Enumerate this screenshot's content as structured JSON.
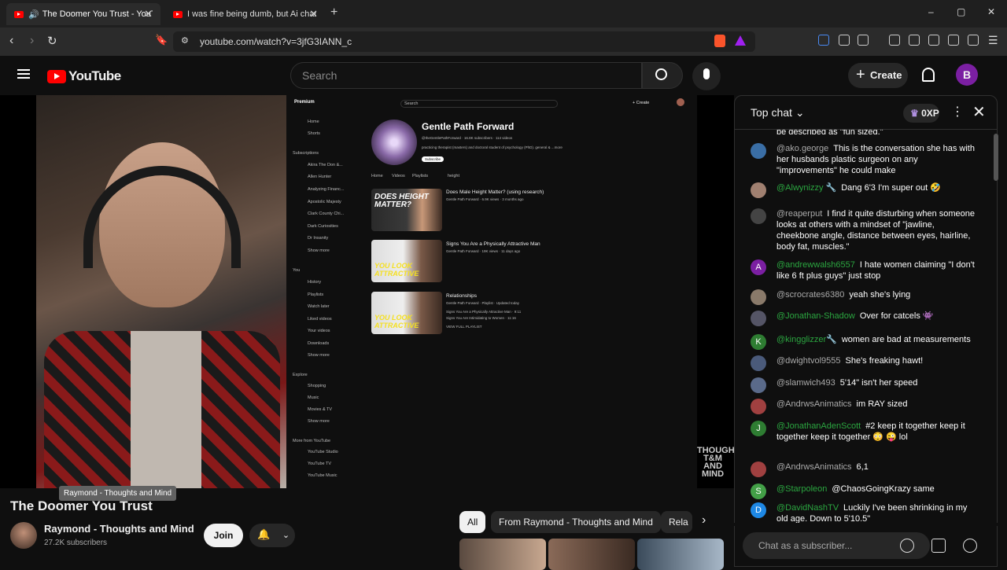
{
  "browser": {
    "tabs": [
      {
        "title": "The Doomer You Trust - YouTube",
        "active": true
      },
      {
        "title": "I was fine being dumb, but Ai change",
        "active": false
      }
    ],
    "url": "youtube.com/watch?v=3jfG3IANN_c",
    "new_tab": "+",
    "window_controls": [
      "–",
      "▢",
      "✕"
    ]
  },
  "youtube": {
    "logo": "YouTube",
    "search_placeholder": "Search",
    "create_label": "Create",
    "avatar_letter": "B"
  },
  "embedded": {
    "premium": "Premium",
    "search": "Search",
    "create": "+ Create",
    "sidebar": [
      "Home",
      "Shorts",
      "Subscriptions",
      "Akira The Don &...",
      "Allen Hunter",
      "Analyzing Financ...",
      "Apostolic Majesty",
      "Clark County Chi...",
      "Dark Curiosities",
      "Dr Insanity",
      "Show more",
      "You",
      "History",
      "Playlists",
      "Watch later",
      "Liked videos",
      "Your videos",
      "Downloads",
      "Show more",
      "Explore",
      "Shopping",
      "Music",
      "Movies & TV",
      "Show more",
      "More from YouTube",
      "YouTube Studio",
      "YouTube TV",
      "YouTube Music"
    ],
    "channel_name": "Gentle Path Forward",
    "channel_handle": "@theGentlePathForward · 16.8K subscribers · 114 videos",
    "channel_desc": "practicing therapist (masters) and doctoral student of psychology (PhD). general & ...more",
    "subscribe": "Subscribe",
    "tabs": [
      "Home",
      "Videos",
      "Playlists",
      "height"
    ],
    "videos": [
      {
        "title": "Does Male Height Matter? (using research)",
        "meta": "Gentle Path Forward · 6.9K views · 3 months ago",
        "thumb_text": "DOES HEIGHT MATTER?"
      },
      {
        "title": "Signs You Are a Physically Attractive Man",
        "meta": "Gentle Path Forward · 19K views · 11 days ago",
        "thumb_text": "YOU LOOK ATTRACTIVE"
      },
      {
        "title": "Relationships",
        "meta": "Gentle Path Forward · Playlist · Updated today",
        "thumb_text": "YOU LOOK ATTRACTIVE",
        "extra": [
          "Signs You Are a Physically Attractive Man · 9:11",
          "Signs You Are Intimidating to Women · 11:16",
          "VIEW FULL PLAYLIST"
        ]
      }
    ],
    "watermark": "THOUGHTS T&M AND MIND"
  },
  "below_video": {
    "title": "The Doomer You Trust",
    "tooltip": "Raymond - Thoughts and Mind",
    "channel": "Raymond - Thoughts and Mind",
    "subscribers": "27.2K subscribers",
    "join": "Join",
    "chips": [
      "All",
      "From Raymond - Thoughts and Mind",
      "Rela"
    ]
  },
  "chat": {
    "header": "Top chat",
    "xp": "0XP",
    "input_placeholder": "Chat as a subscriber...",
    "messages": [
      {
        "author": "",
        "text": "be described as \"fun sized.\"",
        "member": false
      },
      {
        "author": "@ako.george",
        "text": "This is the conversation she has with her husbands plastic surgeon on any \"improvements\" he could make",
        "member": false
      },
      {
        "author": "@Alwynizzy 🔧",
        "text": "Dang 6'3 I'm super out 🤣",
        "member": true
      },
      {
        "author": "@reaperput",
        "text": "I find it quite disturbing when someone looks at others with a mindset of \"jawline, cheekbone angle, distance between eyes, hairline, body fat, muscles.\"",
        "member": false
      },
      {
        "author": "@andrewwalsh6557",
        "text": "I hate women claiming \"I don't like 6 ft plus guys\" just stop",
        "member": true
      },
      {
        "author": "@scrocrates6380",
        "text": "yeah she's lying",
        "member": false
      },
      {
        "author": "@Jonathan-Shadow",
        "text": "Over for catcels 👾",
        "member": true
      },
      {
        "author": "@kingglizzer🔧",
        "text": "women are bad at measurements",
        "member": true
      },
      {
        "author": "@dwightvol9555",
        "text": "She's freaking hawt!",
        "member": false
      },
      {
        "author": "@slamwich493",
        "text": "5'14\" isn't her speed",
        "member": false
      },
      {
        "author": "@AndrwsAnimatics",
        "text": "im RAY sized",
        "member": false
      },
      {
        "author": "@JonathanAdenScott",
        "text": "#2  keep it together keep it together keep it together 😳 😜 lol",
        "member": true
      },
      {
        "author": "@AndrwsAnimatics",
        "text": "6,1",
        "member": false
      },
      {
        "author": "@Starpoleon",
        "text": "@ChaosGoingKrazy same",
        "member": true
      },
      {
        "author": "@DavidNashTV",
        "text": "Luckily I've been shrinking in my old age. Down to 5'10.5\"",
        "member": true
      }
    ],
    "avatar_letters": [
      "",
      "",
      "",
      "",
      "A",
      "",
      "",
      "K",
      "",
      "",
      "",
      "J",
      "",
      "S",
      "D"
    ],
    "avatar_colors": [
      "#333",
      "#3a6ea5",
      "#a08070",
      "#444",
      "#7b1fa2",
      "#8a7a6a",
      "#556",
      "#2e7d32",
      "#4a5a7a",
      "#5a6a8a",
      "#a04040",
      "#2e7d32",
      "#a04040",
      "#43a047",
      "#1e88e5"
    ]
  }
}
